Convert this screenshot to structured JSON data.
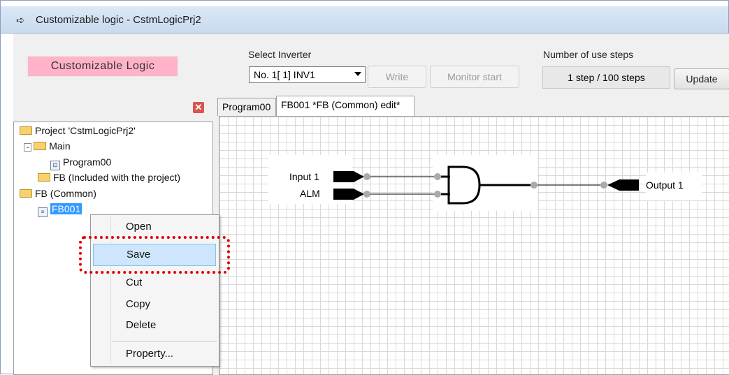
{
  "window": {
    "title": "Customizable logic - CstmLogicPrj2",
    "title_icon": "logic-app-icon"
  },
  "header": {
    "logo_label": "Customizable Logic",
    "select_inverter_label": "Select Inverter",
    "inverter_value": "No. 1[  1] INV1",
    "write_button": "Write",
    "monitor_button": "Monitor start",
    "steps_label": "Number of use steps",
    "steps_value": "1 step / 100 steps",
    "update_button": "Update"
  },
  "tree": {
    "project": "Project 'CstmLogicPrj2'",
    "main": "Main",
    "program": "Program00",
    "fb_included": "FB (Included with the project)",
    "fb_common": "FB (Common)",
    "fb001": "FB001"
  },
  "tabs": [
    {
      "label": "Program00"
    },
    {
      "label": "FB001 *FB (Common) edit*"
    }
  ],
  "diagram": {
    "input1": "Input 1",
    "input2": "ALM",
    "output1": "Output 1"
  },
  "context_menu": {
    "items": [
      "Open",
      "Save",
      "Cut",
      "Copy",
      "Delete",
      "Property..."
    ],
    "highlighted": "Save"
  },
  "colors": {
    "logo_bg": "#ffb3c8",
    "selection": "#3399ff",
    "annotation": "#e00000"
  }
}
